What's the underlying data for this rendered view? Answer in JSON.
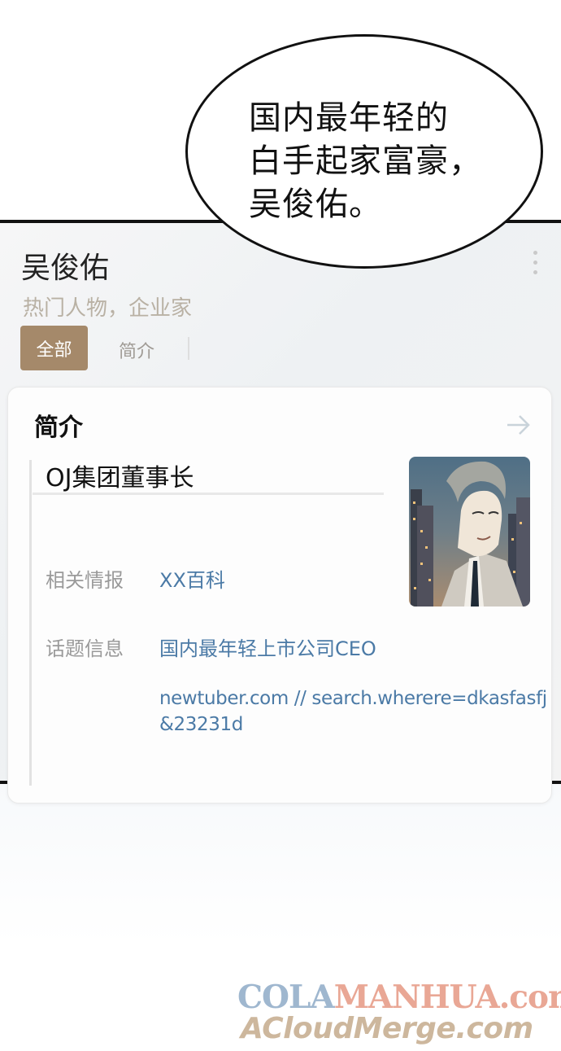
{
  "speech_bubble": {
    "lines": [
      "国内最年轻的",
      "白手起家富豪，",
      "吴俊佑。"
    ]
  },
  "profile": {
    "name": "吴俊佑",
    "subtitle": "热门人物，企业家",
    "tabs": [
      "全部",
      "简介"
    ]
  },
  "intro_card": {
    "title": "简介",
    "role": "OJ集团董事长",
    "rows": [
      {
        "label": "相关情报",
        "value": "XX百科"
      },
      {
        "label": "话题信息",
        "value": "国内最年轻上市公司CEO"
      }
    ],
    "url_line1": "newtuber.com // search.wherere=dkasfasfj",
    "url_line2": "&23231d"
  },
  "watermark": {
    "line1_part1": "COLA",
    "line1_part2": "MANHUA.com",
    "line2": "ACloudMerge.com"
  },
  "colors": {
    "tab_active_bg": "#a5896a",
    "link_blue": "#4b7aa6",
    "subtitle_beige": "#b9b1a4"
  }
}
